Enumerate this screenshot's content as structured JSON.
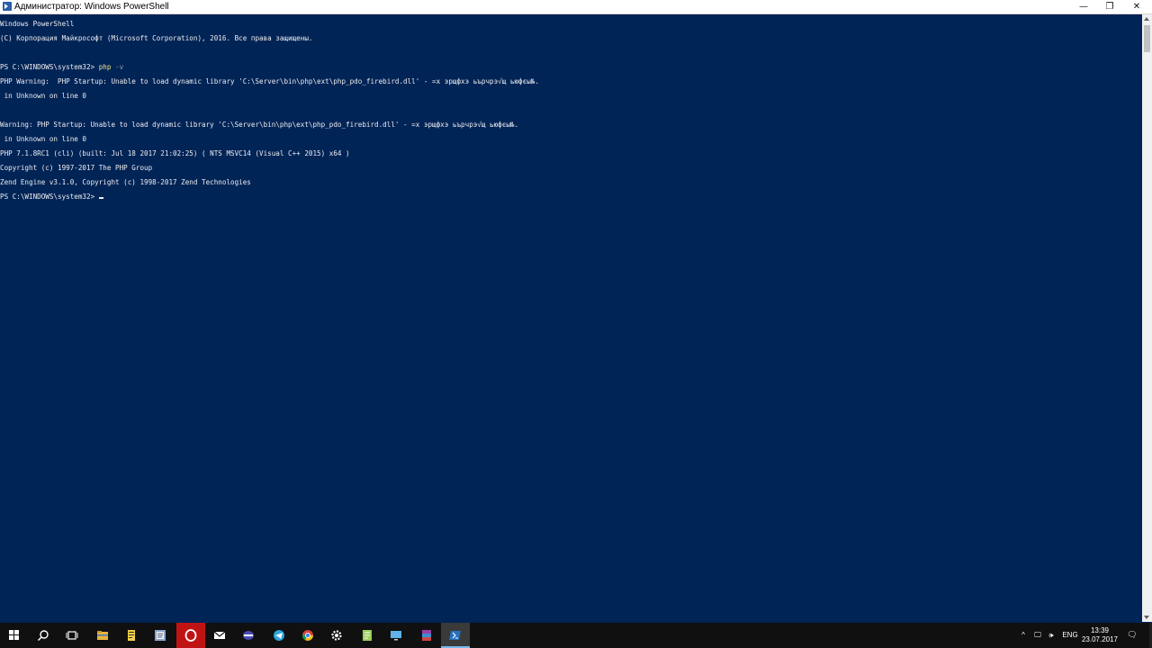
{
  "window": {
    "title": "Администратор: Windows PowerShell",
    "minimize_glyph": "—",
    "maximize_glyph": "❐",
    "close_glyph": "✕"
  },
  "console": {
    "lines": [
      "Windows PowerShell",
      "(C) Корпорация Майкрософт (Microsoft Corporation), 2016. Все права защищены.",
      "",
      "PS C:\\WINDOWS\\system32> ",
      "PHP Warning:  PHP Startup: Unable to load dynamic library 'C:\\Server\\bin\\php\\ext\\php_pdo_firebird.dll' - =х эрщфхэ ьърчрэ√щ ьюфєы№.",
      " in Unknown on line 0",
      "",
      "Warning: PHP Startup: Unable to load dynamic library 'C:\\Server\\bin\\php\\ext\\php_pdo_firebird.dll' - =х эрщфхэ ьърчрэ√щ ьюфєы№.",
      " in Unknown on line 0",
      "PHP 7.1.8RC1 (cli) (built: Jul 18 2017 21:02:25) ( NTS MSVC14 (Visual C++ 2015) x64 )",
      "Copyright (c) 1997-2017 The PHP Group",
      "Zend Engine v3.1.0, Copyright (c) 1998-2017 Zend Technologies",
      "PS C:\\WINDOWS\\system32> "
    ],
    "command": "php",
    "command_param": " -v"
  },
  "taskbar": {
    "icons": [
      "windows-start-icon",
      "search-icon",
      "task-view-icon",
      "file-explorer-icon",
      "file-manager-icon",
      "notepad-icon",
      "opera-icon",
      "mail-icon",
      "media-player-icon",
      "telegram-icon",
      "chrome-icon",
      "settings-icon",
      "notepad-plus-icon",
      "remote-desktop-icon",
      "winrar-icon",
      "powershell-icon"
    ]
  },
  "tray": {
    "chevron": "^",
    "network": "🖵",
    "volume": "🕪",
    "language": "ENG",
    "time": "13:39",
    "date": "23.07.2017",
    "notifications": "🗨"
  },
  "colors": {
    "console_bg": "#012456",
    "console_fg": "#eeedf0",
    "command": "#f0e68c",
    "parameter": "#9a9a9a",
    "taskbar_bg": "#101010"
  }
}
